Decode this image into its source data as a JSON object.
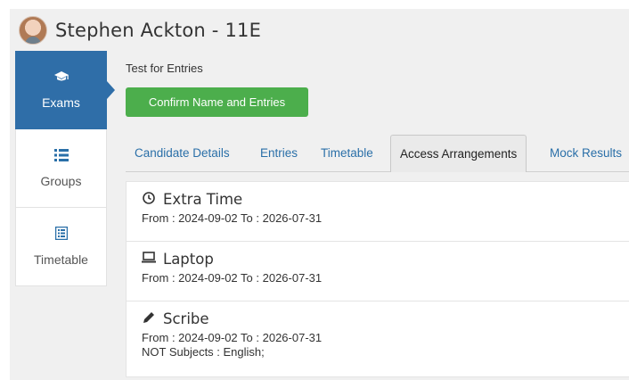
{
  "header": {
    "student_name": "Stephen Ackton - 11E"
  },
  "sidebar": {
    "items": [
      {
        "label": "Exams",
        "icon": "graduation-cap-icon",
        "active": true
      },
      {
        "label": "Groups",
        "icon": "list-icon",
        "active": false
      },
      {
        "label": "Timetable",
        "icon": "timetable-icon",
        "active": false
      }
    ]
  },
  "main": {
    "subject_title": "Test for Entries",
    "confirm_button": "Confirm Name and Entries",
    "tabs": [
      {
        "label": "Candidate Details"
      },
      {
        "label": "Entries"
      },
      {
        "label": "Timetable"
      },
      {
        "label": "Access Arrangements",
        "active": true
      },
      {
        "label": "Mock Results"
      }
    ],
    "arrangements": [
      {
        "title": "Extra Time",
        "icon": "clock-icon",
        "dates": "From : 2024-09-02 To : 2026-07-31"
      },
      {
        "title": "Laptop",
        "icon": "laptop-icon",
        "dates": "From : 2024-09-02 To : 2026-07-31"
      },
      {
        "title": "Scribe",
        "icon": "pencil-icon",
        "dates": "From : 2024-09-02 To : 2026-07-31",
        "note": "NOT Subjects : English;"
      }
    ]
  },
  "colors": {
    "primary": "#2f6ea8",
    "success": "#4cae4c",
    "link": "#2a6fa8"
  }
}
